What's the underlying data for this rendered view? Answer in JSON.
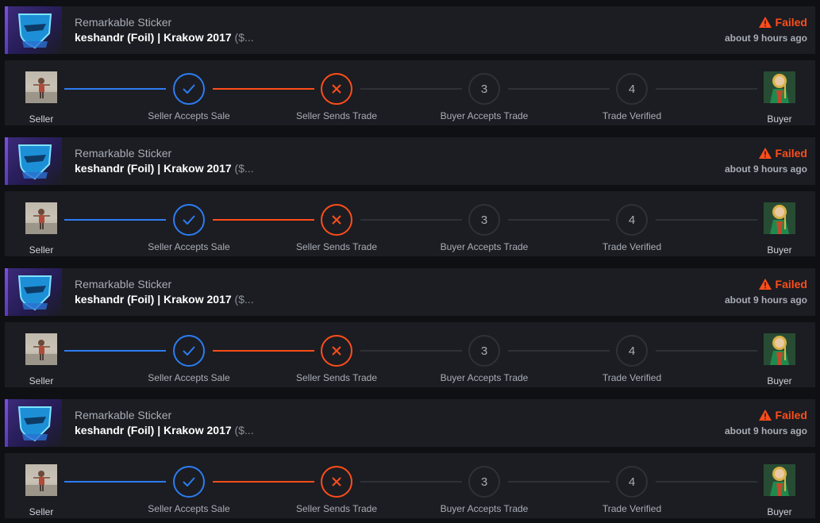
{
  "colors": {
    "accent_blue": "#2d7cf2",
    "failed_orange": "#ff4d1a",
    "panel": "#1b1d22",
    "background": "#0f1013"
  },
  "trades": [
    {
      "item_type": "Remarkable Sticker",
      "item_name": "keshandr (Foil) | Krakow 2017",
      "item_price": " ($...",
      "status": "Failed",
      "status_icon": "warning-icon",
      "time": "about 9 hours ago",
      "seller_label": "Seller",
      "buyer_label": "Buyer",
      "steps": [
        {
          "marker": "check-icon",
          "label": "Seller Accepts Sale"
        },
        {
          "marker": "x-icon",
          "label": "Seller Sends Trade"
        },
        {
          "marker": "3",
          "label": "Buyer Accepts Trade"
        },
        {
          "marker": "4",
          "label": "Trade Verified"
        }
      ]
    },
    {
      "item_type": "Remarkable Sticker",
      "item_name": "keshandr (Foil) | Krakow 2017",
      "item_price": " ($...",
      "status": "Failed",
      "status_icon": "warning-icon",
      "time": "about 9 hours ago",
      "seller_label": "Seller",
      "buyer_label": "Buyer",
      "steps": [
        {
          "marker": "check-icon",
          "label": "Seller Accepts Sale"
        },
        {
          "marker": "x-icon",
          "label": "Seller Sends Trade"
        },
        {
          "marker": "3",
          "label": "Buyer Accepts Trade"
        },
        {
          "marker": "4",
          "label": "Trade Verified"
        }
      ]
    },
    {
      "item_type": "Remarkable Sticker",
      "item_name": "keshandr (Foil) | Krakow 2017",
      "item_price": " ($...",
      "status": "Failed",
      "status_icon": "warning-icon",
      "time": "about 9 hours ago",
      "seller_label": "Seller",
      "buyer_label": "Buyer",
      "steps": [
        {
          "marker": "check-icon",
          "label": "Seller Accepts Sale"
        },
        {
          "marker": "x-icon",
          "label": "Seller Sends Trade"
        },
        {
          "marker": "3",
          "label": "Buyer Accepts Trade"
        },
        {
          "marker": "4",
          "label": "Trade Verified"
        }
      ]
    },
    {
      "item_type": "Remarkable Sticker",
      "item_name": "keshandr (Foil) | Krakow 2017",
      "item_price": " ($...",
      "status": "Failed",
      "status_icon": "warning-icon",
      "time": "about 9 hours ago",
      "seller_label": "Seller",
      "buyer_label": "Buyer",
      "steps": [
        {
          "marker": "check-icon",
          "label": "Seller Accepts Sale"
        },
        {
          "marker": "x-icon",
          "label": "Seller Sends Trade"
        },
        {
          "marker": "3",
          "label": "Buyer Accepts Trade"
        },
        {
          "marker": "4",
          "label": "Trade Verified"
        }
      ]
    }
  ]
}
